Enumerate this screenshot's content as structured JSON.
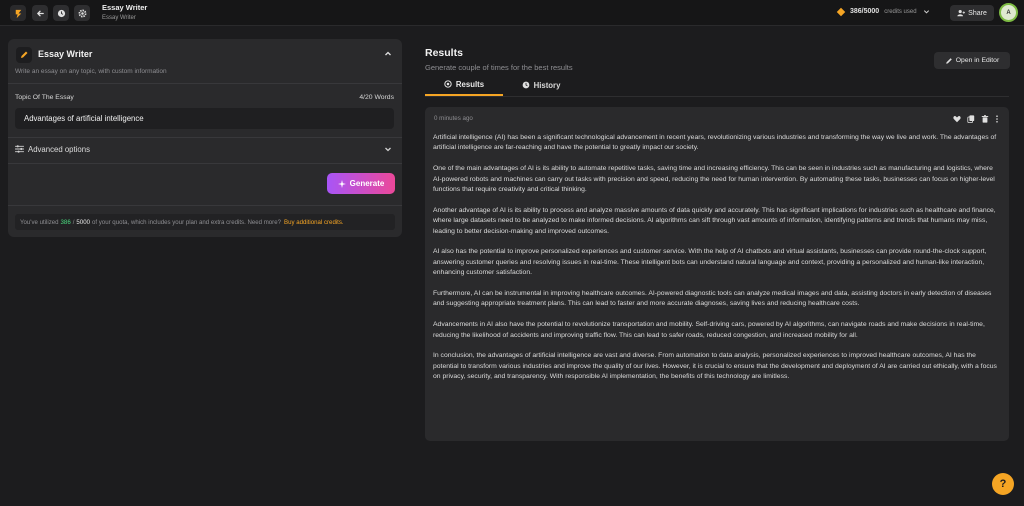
{
  "header": {
    "app_title": "Essay Writer",
    "app_subtitle": "Essay Writer",
    "credits_value": "386/5000",
    "credits_label": "credits used",
    "share_label": "Share",
    "avatar_letter": "A"
  },
  "tool": {
    "title": "Essay Writer",
    "subtitle": "Write an essay on any topic, with custom information",
    "topic_label": "Topic Of The Essay",
    "word_count": "4/20 Words",
    "topic_value": "Advantages of artificial intelligence",
    "advanced_label": "Advanced options",
    "generate_label": "Generate",
    "quota_prefix": "You've utilized",
    "quota_used": "386",
    "quota_sep": "/",
    "quota_total": "5000",
    "quota_suffix": "of your quota, which includes your plan and extra credits. Need more?",
    "quota_link": "Buy additional credits."
  },
  "results": {
    "title": "Results",
    "subtitle": "Generate couple of times for the best results",
    "open_editor_label": "Open in Editor",
    "tabs": [
      {
        "label": "Results"
      },
      {
        "label": "History"
      }
    ],
    "timestamp": "0 minutes ago",
    "paragraphs": [
      "Artificial intelligence (AI) has been a significant technological advancement in recent years, revolutionizing various industries and transforming the way we live and work. The advantages of artificial intelligence are far-reaching and have the potential to greatly impact our society.",
      "One of the main advantages of AI is its ability to automate repetitive tasks, saving time and increasing efficiency. This can be seen in industries such as manufacturing and logistics, where AI-powered robots and machines can carry out tasks with precision and speed, reducing the need for human intervention. By automating these tasks, businesses can focus on higher-level functions that require creativity and critical thinking.",
      "Another advantage of AI is its ability to process and analyze massive amounts of data quickly and accurately. This has significant implications for industries such as healthcare and finance, where large datasets need to be analyzed to make informed decisions. AI algorithms can sift through vast amounts of information, identifying patterns and trends that humans may miss, leading to better decision-making and improved outcomes.",
      "AI also has the potential to improve personalized experiences and customer service. With the help of AI chatbots and virtual assistants, businesses can provide round-the-clock support, answering customer queries and resolving issues in real-time. These intelligent bots can understand natural language and context, providing a personalized and human-like interaction, enhancing customer satisfaction.",
      "Furthermore, AI can be instrumental in improving healthcare outcomes. AI-powered diagnostic tools can analyze medical images and data, assisting doctors in early detection of diseases and suggesting appropriate treatment plans. This can lead to faster and more accurate diagnoses, saving lives and reducing healthcare costs.",
      "Advancements in AI also have the potential to revolutionize transportation and mobility. Self-driving cars, powered by AI algorithms, can navigate roads and make decisions in real-time, reducing the likelihood of accidents and improving traffic flow. This can lead to safer roads, reduced congestion, and increased mobility for all.",
      "In conclusion, the advantages of artificial intelligence are vast and diverse. From automation to data analysis, personalized experiences to improved healthcare outcomes, AI has the potential to transform various industries and improve the quality of our lives. However, it is crucial to ensure that the development and deployment of AI are carried out ethically, with a focus on privacy, security, and transparency. With responsible AI implementation, the benefits of this technology are limitless."
    ]
  },
  "help_label": "?",
  "colors": {
    "accent": "#f5a524",
    "generate_start": "#a855f7",
    "generate_end": "#ec4899",
    "used_green": "#4ade80",
    "panel": "#2a2a2c",
    "background": "#1c1c1e"
  }
}
